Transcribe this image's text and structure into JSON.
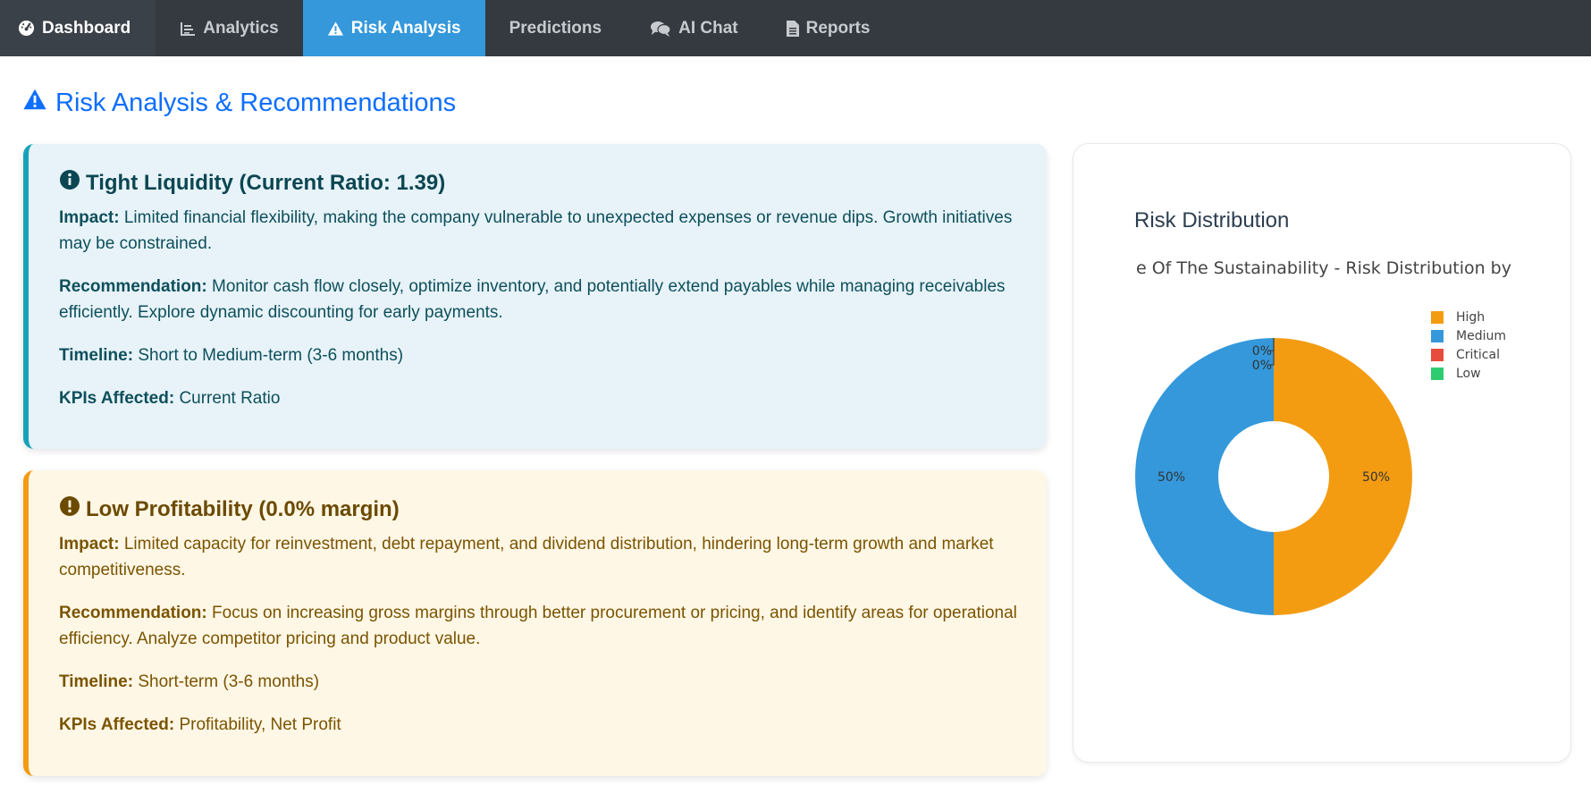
{
  "nav": {
    "brand": "Dashboard",
    "items": [
      "Analytics",
      "Risk Analysis",
      "Predictions",
      "AI Chat",
      "Reports"
    ]
  },
  "page_title": "Risk Analysis & Recommendations",
  "cards": [
    {
      "title": "Tight Liquidity (Current Ratio: 1.39)",
      "impact_label": "Impact:",
      "impact": "Limited financial flexibility, making the company vulnerable to unexpected expenses or revenue dips. Growth initiatives may be constrained.",
      "rec_label": "Recommendation:",
      "rec": "Monitor cash flow closely, optimize inventory, and potentially extend payables while managing receivables efficiently. Explore dynamic discounting for early payments.",
      "timeline_label": "Timeline:",
      "timeline": "Short to Medium-term (3-6 months)",
      "kpi_label": "KPIs Affected:",
      "kpi": "Current Ratio"
    },
    {
      "title": "Low Profitability (0.0% margin)",
      "impact_label": "Impact:",
      "impact": "Limited capacity for reinvestment, debt repayment, and dividend distribution, hindering long-term growth and market competitiveness.",
      "rec_label": "Recommendation:",
      "rec": "Focus on increasing gross margins through better procurement or pricing, and identify areas for operational efficiency. Analyze competitor pricing and product value.",
      "timeline_label": "Timeline:",
      "timeline": "Short-term (3-6 months)",
      "kpi_label": "KPIs Affected:",
      "kpi": "Profitability, Net Profit"
    }
  ],
  "chart_panel": {
    "heading": "Risk Distribution",
    "subtitle": "e Of The Sustainability - Risk Distribution by"
  },
  "colors": {
    "High": "#f39c12",
    "Medium": "#3498db",
    "Critical": "#e74c3c",
    "Low": "#2ecc71"
  },
  "chart_data": {
    "type": "pie",
    "hole": true,
    "legend_position": "top-right",
    "categories": [
      "High",
      "Medium",
      "Critical",
      "Low"
    ],
    "values": [
      50,
      50,
      0,
      0
    ],
    "labels": [
      "50%",
      "50%",
      "0%",
      "0%"
    ]
  }
}
